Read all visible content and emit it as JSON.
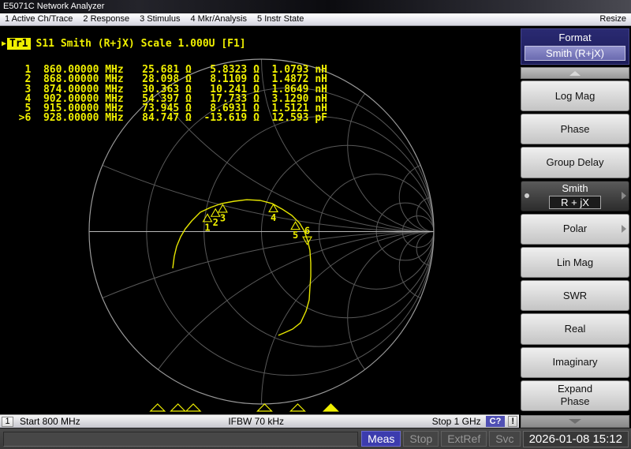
{
  "window": {
    "title": "E5071C Network Analyzer",
    "resize_label": "Resize"
  },
  "menu": {
    "items": [
      "1 Active Ch/Trace",
      "2 Response",
      "3 Stimulus",
      "4 Mkr/Analysis",
      "5 Instr State"
    ]
  },
  "trace_header": {
    "arrow": "▶",
    "trace": "Tr1",
    "text": "S11 Smith (R+jX) Scale 1.000U [F1]"
  },
  "sidebar": {
    "header": {
      "title": "Format",
      "value": "Smith (R+jX)"
    },
    "buttons": [
      {
        "label": "Log Mag"
      },
      {
        "label": "Phase"
      },
      {
        "label": "Group Delay"
      },
      {
        "label": "Smith",
        "sub": "R + jX",
        "selected": true,
        "arrow": true,
        "bullet": true
      },
      {
        "label": "Polar",
        "arrow": true
      },
      {
        "label": "Lin Mag"
      },
      {
        "label": "SWR"
      },
      {
        "label": "Real"
      },
      {
        "label": "Imaginary"
      },
      {
        "label": "Expand\nPhase"
      }
    ]
  },
  "status_bar": {
    "channel": "1",
    "start": "Start 800 MHz",
    "ifbw": "IFBW 70 kHz",
    "stop": "Stop 1 GHz",
    "cal": "C?",
    "warn": "!"
  },
  "bottom_bar": {
    "meas": "Meas",
    "stop": "Stop",
    "extref": "ExtRef",
    "svc": "Svc",
    "datetime": "2026-01-08 15:12"
  },
  "colors": {
    "text_yellow": "#f0f000",
    "trace_yellow": "#e6e600",
    "grid": "#585858",
    "outer_circle": "#9a9a9a",
    "axis": "#b8b8b8",
    "cal_badge_blue": "#5050b4",
    "meas_blue": "#3c3cae",
    "softkey_header_navy": "#23236a"
  },
  "chart_data": {
    "type": "line",
    "chart_style": "smith",
    "title": "S11 Smith (R+jX) Scale 1.000U",
    "z0_ohm": 50,
    "freq_start_mhz": 800,
    "freq_stop_mhz": 1000,
    "freq_unit": "MHz",
    "ohm_symbol": "Ω",
    "grid_r": [
      0.2,
      0.5,
      1,
      2,
      5,
      10
    ],
    "grid_x": [
      0.2,
      0.5,
      1,
      2,
      5,
      10
    ],
    "markers": [
      {
        "n": "1",
        "freq_disp": "860.00000",
        "freq_mhz": 860,
        "r_ohm": 25.681,
        "x_ohm": 5.8323,
        "r_disp": "25.681",
        "x_disp": "5.8323",
        "lc_disp": "1.0793",
        "lc_unit": "nH",
        "active": false
      },
      {
        "n": "2",
        "freq_disp": "868.00000",
        "freq_mhz": 868,
        "r_ohm": 28.098,
        "x_ohm": 8.1109,
        "r_disp": "28.098",
        "x_disp": "8.1109",
        "lc_disp": "1.4872",
        "lc_unit": "nH",
        "active": false
      },
      {
        "n": "3",
        "freq_disp": "874.00000",
        "freq_mhz": 874,
        "r_ohm": 30.363,
        "x_ohm": 10.241,
        "r_disp": "30.363",
        "x_disp": "10.241",
        "lc_disp": "1.8649",
        "lc_unit": "nH",
        "active": false
      },
      {
        "n": "4",
        "freq_disp": "902.00000",
        "freq_mhz": 902,
        "r_ohm": 54.397,
        "x_ohm": 17.733,
        "r_disp": "54.397",
        "x_disp": "17.733",
        "lc_disp": "3.1290",
        "lc_unit": "nH",
        "active": false
      },
      {
        "n": "5",
        "freq_disp": "915.00000",
        "freq_mhz": 915,
        "r_ohm": 73.945,
        "x_ohm": 8.6931,
        "r_disp": "73.945",
        "x_disp": "8.6931",
        "lc_disp": "1.5121",
        "lc_unit": "nH",
        "active": false
      },
      {
        "n": "6",
        "freq_disp": "928.00000",
        "freq_mhz": 928,
        "r_ohm": 84.747,
        "x_ohm": -13.619,
        "r_disp": "84.747",
        "x_disp": "-13.619",
        "lc_disp": "12.593",
        "lc_unit": "pF",
        "active": true
      }
    ],
    "trace_gamma": [
      [
        -0.515,
        -0.213
      ],
      [
        -0.506,
        -0.144
      ],
      [
        -0.492,
        -0.085
      ],
      [
        -0.469,
        -0.03
      ],
      [
        -0.442,
        0.016
      ],
      [
        -0.405,
        0.062
      ],
      [
        -0.355,
        0.112
      ],
      [
        -0.295,
        0.14
      ],
      [
        -0.231,
        0.163
      ],
      [
        -0.158,
        0.176
      ],
      [
        -0.085,
        0.185
      ],
      [
        -0.007,
        0.181
      ],
      [
        0.062,
        0.163
      ],
      [
        0.121,
        0.13
      ],
      [
        0.176,
        0.094
      ],
      [
        0.222,
        0.048
      ],
      [
        0.249,
        0.002
      ],
      [
        0.268,
        -0.053
      ],
      [
        0.281,
        -0.108
      ],
      [
        0.286,
        -0.181
      ],
      [
        0.286,
        -0.259
      ],
      [
        0.281,
        -0.327
      ],
      [
        0.277,
        -0.396
      ],
      [
        0.259,
        -0.46
      ],
      [
        0.227,
        -0.529
      ],
      [
        0.181,
        -0.565
      ],
      [
        0.13,
        -0.588
      ],
      [
        0.098,
        -0.602
      ]
    ]
  }
}
